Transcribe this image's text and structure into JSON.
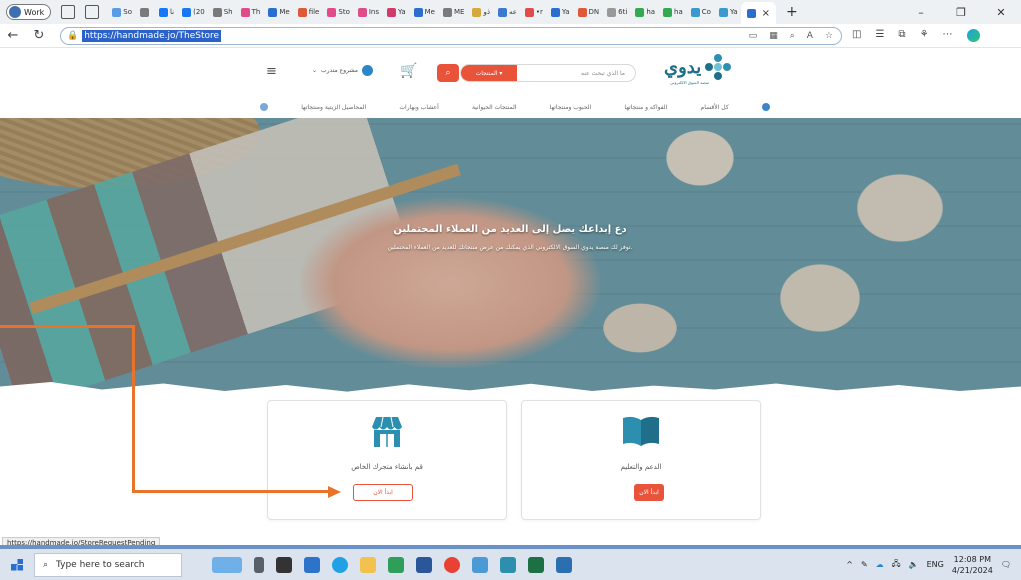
{
  "browser": {
    "profile_label": "Work",
    "tabs": [
      {
        "label": "So",
        "color": "#5a9be6"
      },
      {
        "label": "",
        "color": "#7a7a7a"
      },
      {
        "label": "نا",
        "color": "#1877f2"
      },
      {
        "label": "(20",
        "color": "#1877f2"
      },
      {
        "label": "Sh",
        "color": "#7a7a7a"
      },
      {
        "label": "Th",
        "color": "#e04b8a"
      },
      {
        "label": "Me",
        "color": "#2a6fd0"
      },
      {
        "label": "file",
        "color": "#e0583a"
      },
      {
        "label": "Sto",
        "color": "#e04b8a"
      },
      {
        "label": "Ins",
        "color": "#e04b8a"
      },
      {
        "label": "Ya",
        "color": "#d13b6a"
      },
      {
        "label": "Me",
        "color": "#2a6fd0"
      },
      {
        "label": "ME",
        "color": "#7a7a7a"
      },
      {
        "label": "ذو",
        "color": "#d7a83a"
      },
      {
        "label": "عه",
        "color": "#3a7ad0"
      },
      {
        "label": "•r",
        "color": "#e04b4b"
      },
      {
        "label": "Ya",
        "color": "#2a6fd0"
      },
      {
        "label": "DN",
        "color": "#e0583a"
      },
      {
        "label": "6ti",
        "color": "#999"
      },
      {
        "label": "ha",
        "color": "#34a853"
      },
      {
        "label": "ha",
        "color": "#34a853"
      },
      {
        "label": "Co",
        "color": "#3a9ad0"
      },
      {
        "label": "Ya",
        "color": "#3a9ad0"
      }
    ],
    "active_tab_close": "×",
    "new_tab": "+",
    "url": "https://handmade.jo/TheStore",
    "status_url": "https://handmade.jo/StoreRequestPending"
  },
  "site": {
    "logo_text": "يدوي",
    "logo_sub": "منصة السوق الالكتروني",
    "search_category": "المنتجات",
    "search_placeholder": "ما الذي تبحث عنه",
    "account_label": "مشروع متدرب",
    "nav": [
      "كل الأقسام",
      "الفواكه و منتجاتها",
      "الحبوب ومنتجاتها",
      "المنتجات الحيوانية",
      "أعشاب وبهارات",
      "المحاصيل الزيتية ومنتجاتها"
    ]
  },
  "hero": {
    "title": "دع إبداعك يصل إلى العديد من العملاء المحتملين",
    "subtitle": "توفر لك منصة يدوي السوق الالكتروني الذي يمكنك من عرض منتجاتك للعديد من العملاء المحتملين."
  },
  "cards": {
    "store": {
      "title": "قم بانشاء متجرك الخاص",
      "button": "ابدأ الان"
    },
    "support": {
      "title": "الدعم والتعليم",
      "button": "ابدأ الان"
    }
  },
  "taskbar": {
    "search_placeholder": "Type here to search",
    "lang": "ENG",
    "time": "12:08 PM",
    "date": "4/21/2024"
  },
  "colors": {
    "accent": "#e8533a",
    "brand": "#1f6f8a",
    "annotation": "#e8742c"
  }
}
